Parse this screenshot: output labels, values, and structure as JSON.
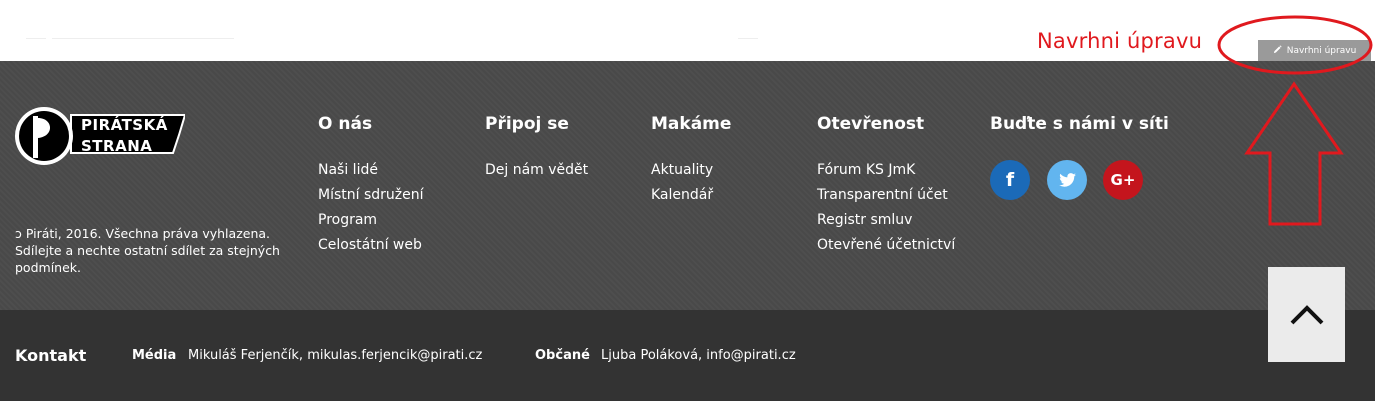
{
  "annotation": {
    "label": "Navrhni úpravu",
    "color": "#e0191e"
  },
  "suggest_button": {
    "icon": "pencil-icon",
    "label": "Navrhni úpravu"
  },
  "logo": {
    "line1": "PIRÁTSKÁ",
    "line2": "STRANA"
  },
  "copyright": {
    "text": "Piráti, 2016. Všechna práva vyhlazena. Sdílejte a nechte ostatní sdílet za stejných podmínek.",
    "icon": "copyleft-icon"
  },
  "columns": [
    {
      "title": "O nás",
      "links": [
        "Naši lidé",
        "Místní sdružení",
        "Program",
        "Celostátní web"
      ]
    },
    {
      "title": "Připoj se",
      "links": [
        "Dej nám vědět"
      ]
    },
    {
      "title": "Makáme",
      "links": [
        "Aktuality",
        "Kalendář"
      ]
    },
    {
      "title": "Otevřenost",
      "links": [
        "Fórum KS JmK",
        "Transparentní účet",
        "Registr smluv",
        "Otevřené účetnictví"
      ]
    },
    {
      "title": "Buďte s námi v síti",
      "links": []
    }
  ],
  "social": {
    "facebook": {
      "icon": "facebook-icon",
      "glyph": "f",
      "color": "#1b6ab8"
    },
    "twitter": {
      "icon": "twitter-icon",
      "color": "#62b5ef"
    },
    "googleplus": {
      "icon": "google-plus-icon",
      "glyph": "G+",
      "color": "#c4151d"
    }
  },
  "contact": {
    "title": "Kontakt",
    "media_label": "Média",
    "media_value": "Mikuláš Ferjenčík, mikulas.ferjencik@pirati.cz",
    "citizens_label": "Občané",
    "citizens_value": "Ljuba Poláková, info@pirati.cz"
  },
  "scroll_top": {
    "icon": "chevron-up-icon"
  },
  "colors": {
    "footer_main": "#4a4a4a",
    "footer_bottom": "#333333"
  }
}
